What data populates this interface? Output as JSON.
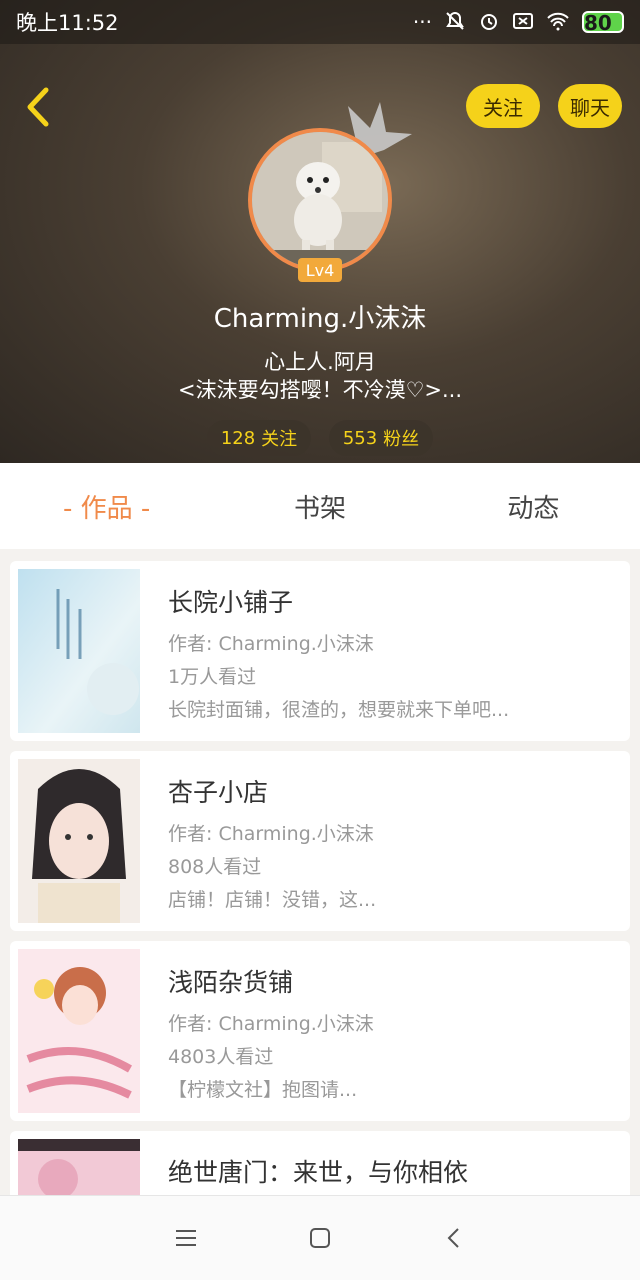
{
  "status_bar": {
    "time": "晚上11:52",
    "battery": "80",
    "icons": [
      "more-dots-icon",
      "mute-icon",
      "alarm-icon",
      "sim-icon",
      "wifi-icon",
      "battery-icon"
    ]
  },
  "header": {
    "follow_label": "关注",
    "chat_label": "聊天",
    "level": "Lv4",
    "username": "Charming.小沫沫",
    "bio_line1": "心上人.阿月",
    "bio_line2": "<沫沫要勾搭嘤！不冷漠♡>...",
    "following_count": "128",
    "following_label": "关注",
    "fans_count": "553",
    "fans_label": "粉丝"
  },
  "tabs": [
    {
      "label": "- 作品 -",
      "active": true
    },
    {
      "label": "书架",
      "active": false
    },
    {
      "label": "动态",
      "active": false
    }
  ],
  "works": [
    {
      "title": "长院小铺子",
      "author": "作者: Charming.小沫沫",
      "views": "1万人看过",
      "desc": "长院封面铺，很渣的，想要就来下单吧..."
    },
    {
      "title": "杏子小店",
      "author": "作者: Charming.小沫沫",
      "views": "808人看过",
      "desc": "店铺！店铺！没错，这..."
    },
    {
      "title": "浅陌杂货铺",
      "author": "作者: Charming.小沫沫",
      "views": "4803人看过",
      "desc": "【柠檬文社】抱图请..."
    },
    {
      "title": "绝世唐门：来世，与你相依",
      "author": "",
      "views": "",
      "desc": ""
    }
  ],
  "colors": {
    "accent": "#f08a4a",
    "button_yellow": "#f5d21a",
    "stat_text": "#f5d21a"
  }
}
